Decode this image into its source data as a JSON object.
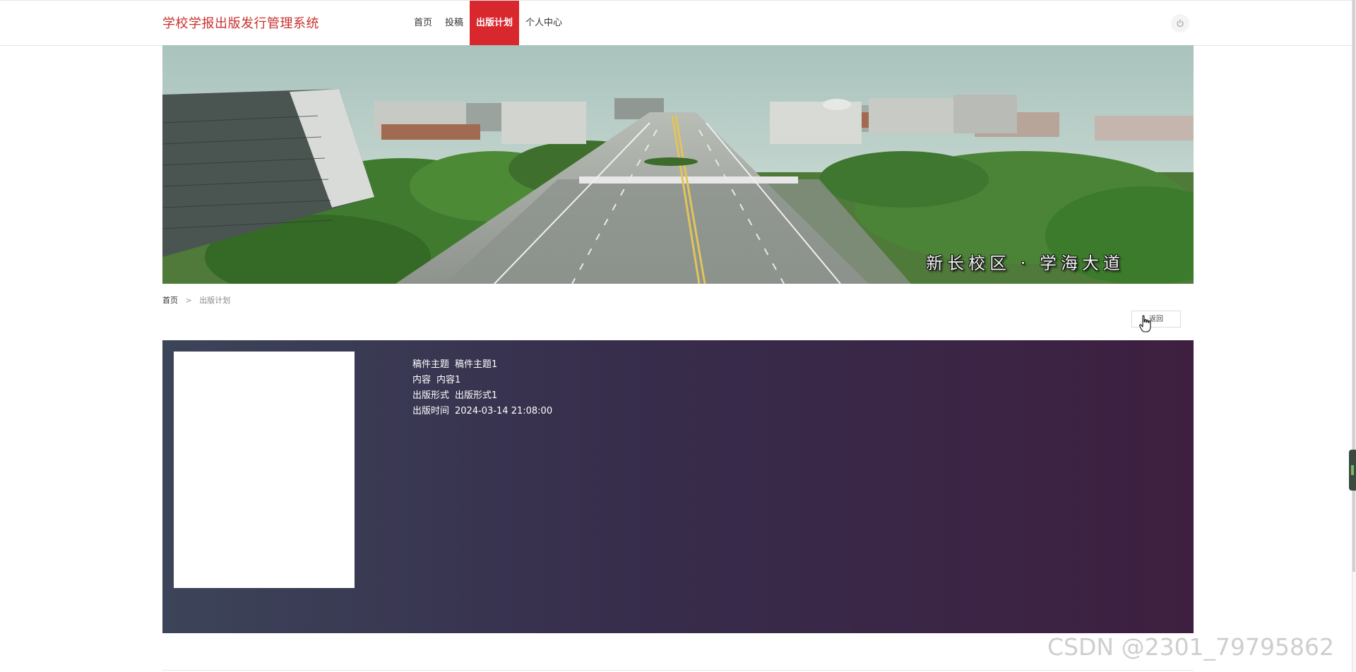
{
  "header": {
    "brand": "学校学报出版发行管理系统",
    "nav": [
      {
        "label": "首页",
        "active": false
      },
      {
        "label": "投稿",
        "active": false
      },
      {
        "label": "出版计划",
        "active": true
      },
      {
        "label": "个人中心",
        "active": false
      }
    ],
    "power_icon": "power-icon"
  },
  "banner": {
    "caption": "新长校区 · 学海大道"
  },
  "breadcrumb": {
    "home": "首页",
    "separator": ">",
    "current": "出版计划"
  },
  "back_button": {
    "label": "返回"
  },
  "detail": {
    "fields": [
      {
        "label": "稿件主题",
        "value": "稿件主题1"
      },
      {
        "label": "内容",
        "value": "内容1"
      },
      {
        "label": "出版形式",
        "value": "出版形式1"
      },
      {
        "label": "出版时间",
        "value": "2024-03-14 21:08:00"
      }
    ]
  },
  "watermark": "CSDN @2301_79795862",
  "colors": {
    "brand": "#c9302c",
    "nav_active_bg": "#d9272e",
    "panel_gradient_start": "#3c4459",
    "panel_gradient_end": "#3e1f40"
  }
}
